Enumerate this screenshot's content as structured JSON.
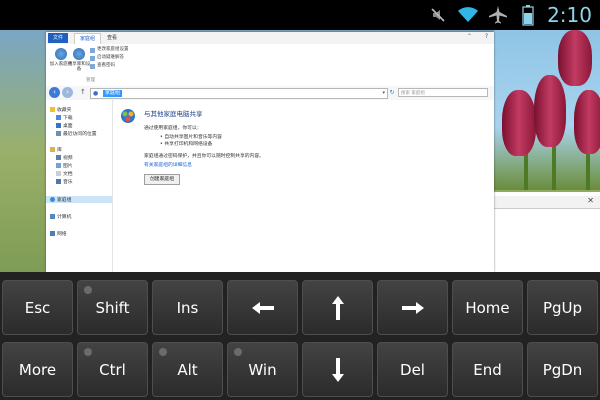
{
  "status_bar": {
    "time": "2:10",
    "icons": [
      "mute-icon",
      "wifi-icon",
      "airplane-mode-icon",
      "battery-icon"
    ]
  },
  "explorer": {
    "ribbon_tabs": [
      "文件",
      "家庭组",
      "查看"
    ],
    "ribbon_buttons": [
      "加入家庭组",
      "共享库和设备"
    ],
    "ribbon_list": [
      "更改家庭组设置",
      "启动疑难解答",
      "查看密码"
    ],
    "ribbon_group_label": "管理",
    "address_text": "家庭组",
    "search_placeholder": "搜索 家庭组",
    "nav": {
      "favorites": "收藏夹",
      "downloads": "下载",
      "desktop": "桌面",
      "recent": "最近访问的位置",
      "libraries": "库",
      "videos": "视频",
      "pictures": "图片",
      "documents": "文档",
      "music": "音乐",
      "homegroup": "家庭组",
      "computer": "计算机",
      "network": "网络"
    },
    "content": {
      "title": "与其他家庭电脑共享",
      "lead": "通过使用家庭组，你可以：",
      "bullet1": "自动共享图片和音乐等内容",
      "bullet2": "共享打印机和网络设备",
      "description": "家庭组通过密码保护，并且你可以随时控制共享的内容。",
      "link": "有关家庭组的详细信息",
      "button": "创建家庭组"
    }
  },
  "keyboard": {
    "row1": [
      "Esc",
      "Shift",
      "Ins",
      "left-arrow",
      "up-arrow",
      "right-arrow",
      "Home",
      "PgUp"
    ],
    "row2": [
      "More",
      "Ctrl",
      "Alt",
      "Win",
      "down-arrow",
      "Del",
      "End",
      "PgDn"
    ],
    "labels": {
      "esc": "Esc",
      "shift": "Shift",
      "ins": "Ins",
      "home": "Home",
      "pgup": "PgUp",
      "more": "More",
      "ctrl": "Ctrl",
      "alt": "Alt",
      "win": "Win",
      "del": "Del",
      "end": "End",
      "pgdn": "PgDn"
    }
  }
}
